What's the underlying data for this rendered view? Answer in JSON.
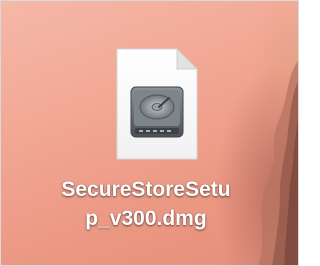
{
  "desktop": {
    "file": {
      "name_line1": "SecureStoreSetu",
      "name_line2": "p_v300.dmg",
      "icon": "disk-image-icon"
    },
    "wallpaper": {
      "colors": [
        "#f6b8a8",
        "#ef9f8c",
        "#e48f7d"
      ]
    }
  }
}
